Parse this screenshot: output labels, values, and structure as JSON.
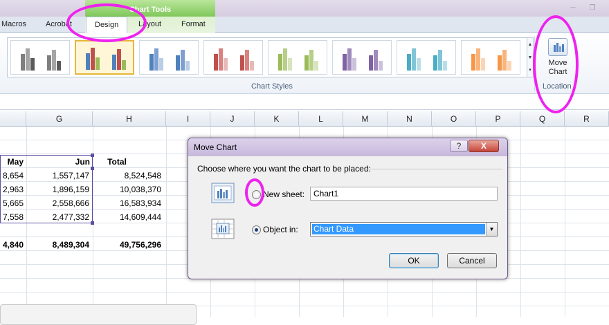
{
  "ribbon": {
    "context_title": "Chart Tools",
    "tabs": [
      "Macros",
      "Acrobat",
      "Design",
      "Layout",
      "Format"
    ],
    "active_tab": "Design",
    "chart_styles_label": "Chart Styles",
    "location_label": "Location",
    "move_chart_label_1": "Move",
    "move_chart_label_2": "Chart"
  },
  "styles_colors": [
    [
      "#7f7f7f",
      "#a5a5a5",
      "#5a5a5a"
    ],
    [
      "#4f81bd",
      "#c0504d",
      "#9bbb59"
    ],
    [
      "#4f81bd",
      "#7e9fd1",
      "#b9cde5"
    ],
    [
      "#c0504d",
      "#d9827f",
      "#e6b9b8"
    ],
    [
      "#9bbb59",
      "#b7cf87",
      "#d7e4bd"
    ],
    [
      "#8064a2",
      "#a08bbd",
      "#ccc1da"
    ],
    [
      "#4bacc6",
      "#80c5d7",
      "#b7dee8"
    ],
    [
      "#f79646",
      "#f9b47c",
      "#fcd5b5"
    ]
  ],
  "columns": [
    "G",
    "H",
    "I",
    "J",
    "K",
    "L",
    "M",
    "N",
    "O",
    "P",
    "Q",
    "R"
  ],
  "sheet": {
    "headers": {
      "may": "May",
      "jun": "Jun",
      "total": "Total"
    },
    "rows": [
      {
        "may": "8,654",
        "jun": "1,557,147",
        "total": "8,524,548"
      },
      {
        "may": "2,963",
        "jun": "1,896,159",
        "total": "10,038,370"
      },
      {
        "may": "5,665",
        "jun": "2,558,666",
        "total": "16,583,934"
      },
      {
        "may": "7,558",
        "jun": "2,477,332",
        "total": "14,609,444"
      }
    ],
    "totals": {
      "may": "4,840",
      "jun": "8,489,304",
      "total": "49,756,296"
    }
  },
  "dialog": {
    "title": "Move Chart",
    "help": "?",
    "close": "X",
    "prompt": "Choose where you want the chart to be placed:",
    "new_sheet_label": "New sheet:",
    "new_sheet_value": "Chart1",
    "object_in_label": "Object in:",
    "object_in_value": "Chart Data",
    "selected_option": "object_in",
    "ok": "OK",
    "cancel": "Cancel"
  },
  "annotation_color": "#ee22ee"
}
